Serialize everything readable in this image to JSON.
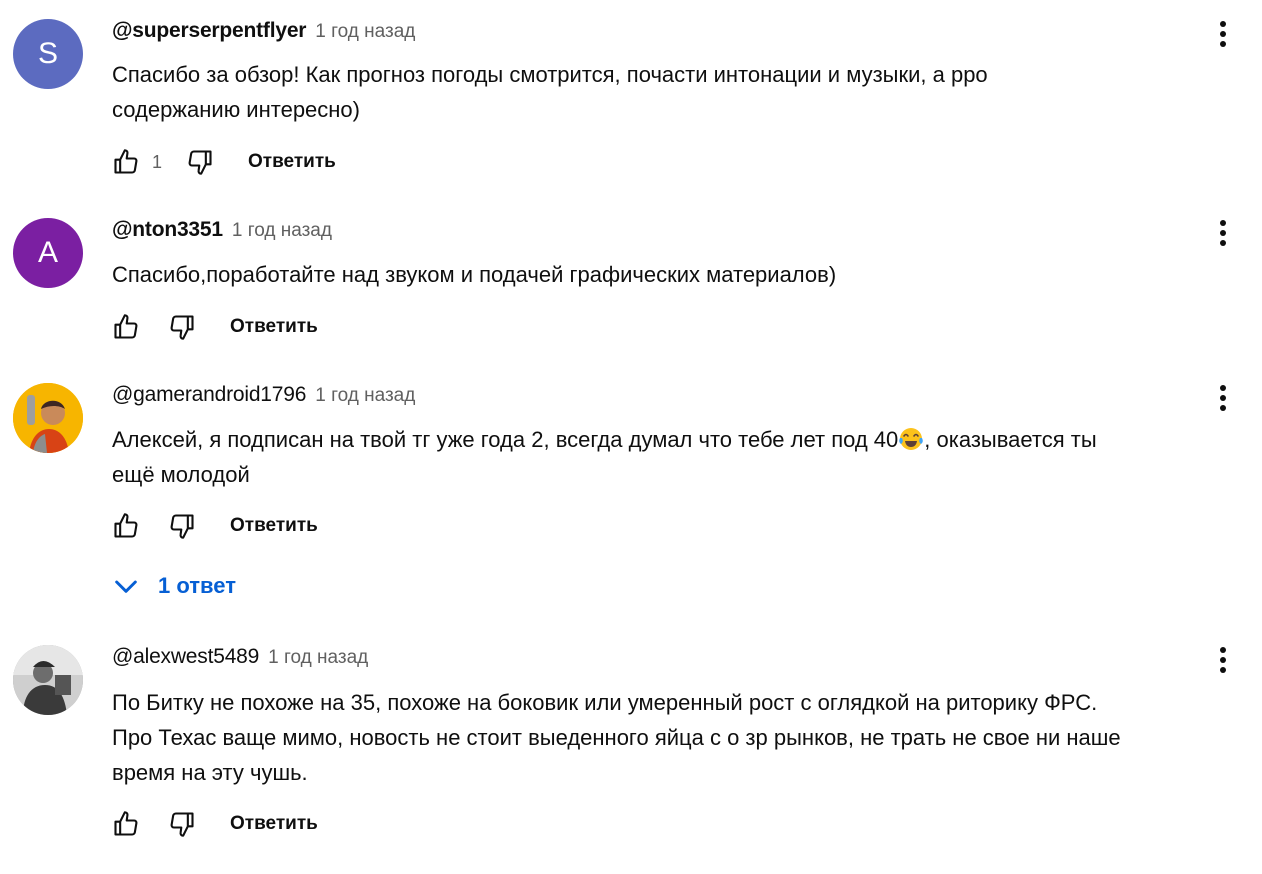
{
  "comments": [
    {
      "author": "@superserpentflyer",
      "time": "1 год назад",
      "avatar_letter": "S",
      "avatar_color": "#5c6bc0",
      "text_lines": [
        "Спасибо за обзор! Как прогноз погоды смотрится, почасти интонации и музыки, а рро",
        "содержанию интересно)"
      ],
      "likes": "1",
      "reply_label": "Ответить"
    },
    {
      "author": "@nton3351",
      "time": "1 год назад",
      "avatar_letter": "A",
      "avatar_color": "#7b1fa2",
      "text_lines": [
        "Спасибо,поработайте над звуком и подачей графических материалов)"
      ],
      "reply_label": "Ответить"
    },
    {
      "author": "@gamerandroid1796",
      "time": "1 год назад",
      "avatar_icon": "cartoon-person-avatar",
      "text_before_emoji": "Алексей, я подписан на твой тг уже года 2, всегда думал что тебе лет под 40",
      "emoji_icon": "tears-of-joy-emoji",
      "text_after_emoji": ", оказывается ты",
      "text_line2": "ещё молодой",
      "reply_label": "Ответить",
      "replies_label": "1 ответ"
    },
    {
      "author": "@alexwest5489",
      "time": "1 год назад",
      "avatar_icon": "photo-grayscale-avatar",
      "text_lines": [
        "По Битку не похоже на 35, похоже на боковик или умеренный рост с оглядкой  на риторику ФРС.",
        "Про Техас ваще мимо, новость не стоит  выеденного яйца с о зр рынков, не трать не свое ни наше",
        "время на эту чушь."
      ],
      "reply_label": "Ответить"
    }
  ],
  "colors": {
    "link_blue": "#065fd4",
    "secondary_text": "#606060"
  }
}
